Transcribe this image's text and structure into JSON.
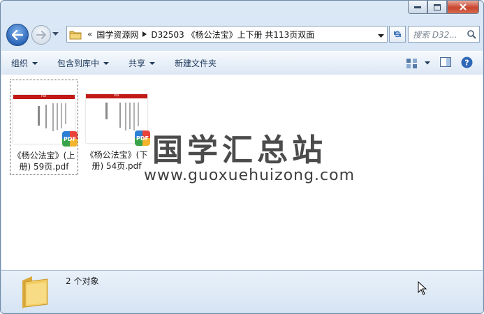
{
  "address": {
    "overflow": "«",
    "crumbs": [
      "国学资源网",
      "D32503 《杨公法宝》上下册 共113页双面"
    ]
  },
  "search": {
    "placeholder": "搜索 D32..."
  },
  "toolbar": {
    "organize": "组织",
    "include_library": "包含到库中",
    "share": "共享",
    "new_folder": "新建文件夹"
  },
  "files": [
    {
      "name": "《杨公法宝》(上册) 59页.pdf",
      "badge": "PDF",
      "thumb_label": "PDF"
    },
    {
      "name": "《杨公法宝》(下册) 54页.pdf",
      "badge": "PDF",
      "thumb_label": "PDF"
    }
  ],
  "watermark": {
    "title": "国学汇总站",
    "url": "www.guoxuehuizong.com"
  },
  "status": {
    "count": "2 个对象"
  }
}
